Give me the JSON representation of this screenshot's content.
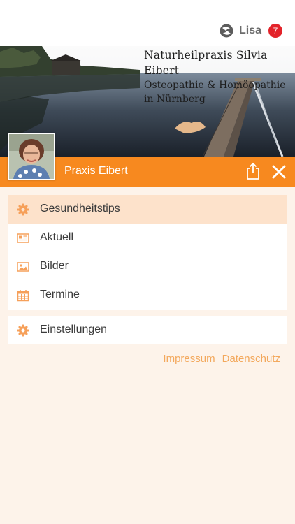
{
  "header": {
    "user_name": "Lisa",
    "notification_count": "7",
    "user_icon": "profile-swirl-icon"
  },
  "banner": {
    "title": "Naturheilpraxis Silvia Eibert",
    "subtitle_line1": "Osteopathie & Homöopathie",
    "subtitle_line2": "in Nürnberg"
  },
  "titlebar": {
    "title": "Praxis Eibert",
    "share_icon": "share-icon",
    "close_icon": "close-icon",
    "background_color": "#f7891f"
  },
  "menu": {
    "items": [
      {
        "label": "Gesundheitstips",
        "icon": "gear-icon",
        "active": true
      },
      {
        "label": "Aktuell",
        "icon": "newspaper-icon",
        "active": false
      },
      {
        "label": "Bilder",
        "icon": "image-icon",
        "active": false
      },
      {
        "label": "Termine",
        "icon": "calendar-icon",
        "active": false
      }
    ],
    "settings": {
      "label": "Einstellungen",
      "icon": "gear-icon"
    }
  },
  "footer": {
    "impressum": "Impressum",
    "datenschutz": "Datenschutz"
  },
  "colors": {
    "accent": "#f7891f",
    "icon": "#f6a05a",
    "active_row": "#fde2cb",
    "page_background": "#fdf3ea",
    "badge": "#e3232a"
  }
}
